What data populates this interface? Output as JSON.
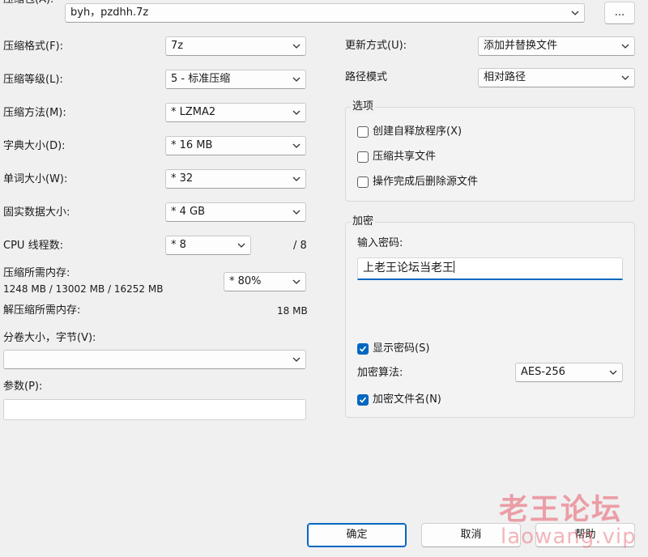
{
  "archive": {
    "label": "压缩包(A):",
    "path": "byh，pzdhh.7z",
    "browse_label": "..."
  },
  "left": {
    "format": {
      "label": "压缩格式(F):",
      "value": "7z"
    },
    "level": {
      "label": "压缩等级(L):",
      "value": "5 - 标准压缩"
    },
    "method": {
      "label": "压缩方法(M):",
      "value": "* LZMA2"
    },
    "dict": {
      "label": "字典大小(D):",
      "value": "* 16 MB"
    },
    "word": {
      "label": "单词大小(W):",
      "value": "* 32"
    },
    "solid": {
      "label": "固实数据大小:",
      "value": "* 4 GB"
    },
    "threads": {
      "label": "CPU 线程数:",
      "value": "* 8",
      "max": "/ 8"
    },
    "memory": {
      "label": "压缩所需内存:",
      "detail": "1248 MB / 13002 MB / 16252 MB",
      "value": "* 80%"
    },
    "decomp": {
      "label": "解压缩所需内存:",
      "value": "18 MB"
    },
    "volume": {
      "label": "分卷大小，字节(V):",
      "value": ""
    },
    "params": {
      "label": "参数(P):",
      "value": ""
    }
  },
  "right": {
    "update": {
      "label": "更新方式(U):",
      "value": "添加并替换文件"
    },
    "pathmode": {
      "label": "路径模式",
      "value": "相对路径"
    },
    "options": {
      "title": "选项",
      "items": [
        {
          "label": "创建自释放程序(X)",
          "checked": false
        },
        {
          "label": "压缩共享文件",
          "checked": false
        },
        {
          "label": "操作完成后删除源文件",
          "checked": false
        }
      ]
    },
    "encryption": {
      "title": "加密",
      "password_label": "输入密码:",
      "password": "上老王论坛当老王",
      "show_password": {
        "label": "显示密码(S)",
        "checked": true
      },
      "method_label": "加密算法:",
      "method": "AES-256",
      "encrypt_names": {
        "label": "加密文件名(N)",
        "checked": true
      }
    }
  },
  "buttons": {
    "ok": "确定",
    "cancel": "取消",
    "help": "帮助"
  },
  "watermark": {
    "line1": "老王论坛",
    "line2": "laowang.vip"
  },
  "colors": {
    "accent": "#0067c0",
    "background": "#f0f0f0",
    "watermark": "#e85a69"
  }
}
